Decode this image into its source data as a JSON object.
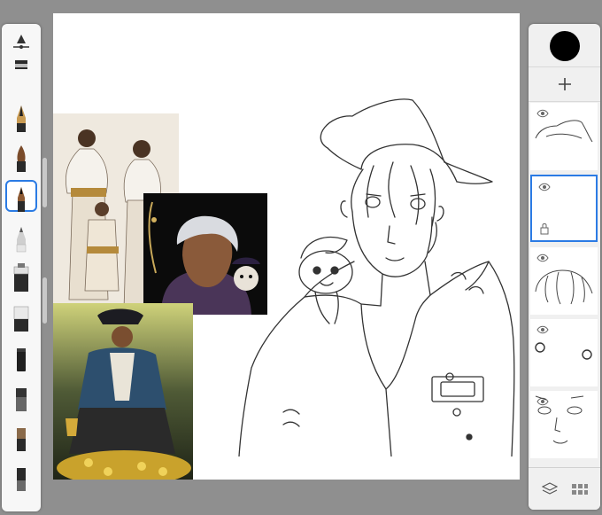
{
  "app": {
    "colors": {
      "background": "#8f8f8f",
      "canvas": "#ffffff",
      "panel": "#f0f0f0",
      "selection": "#2b7be4",
      "current_color": "#000000"
    }
  },
  "brush_palette": {
    "handle_icon": "triangle-slider-icon",
    "brushes": [
      {
        "icon": "marker-brush-icon",
        "selected": false
      },
      {
        "icon": "ink-pen-brush-icon",
        "selected": false
      },
      {
        "icon": "paintbrush-brush-icon",
        "selected": false
      },
      {
        "icon": "ballpoint-pen-brush-icon",
        "selected": true
      },
      {
        "icon": "pencil-brush-icon",
        "selected": false
      },
      {
        "icon": "airbrush-brush-icon",
        "selected": false
      },
      {
        "icon": "eraser-brush-icon",
        "selected": false
      },
      {
        "icon": "chalk-brush-icon",
        "selected": false
      },
      {
        "icon": "flat-brush-icon",
        "selected": false
      },
      {
        "icon": "sponge-brush-icon",
        "selected": false
      },
      {
        "icon": "wide-brush-icon",
        "selected": false
      }
    ]
  },
  "layers_panel": {
    "current_color": "#000000",
    "add_icon": "plus-icon",
    "layers": [
      {
        "name": "hat-sketch",
        "visible": true,
        "active": false
      },
      {
        "name": "empty",
        "visible": true,
        "active": true
      },
      {
        "name": "hair-sketch",
        "visible": true,
        "active": false
      },
      {
        "name": "eyes-sketch",
        "visible": true,
        "active": false
      },
      {
        "name": "face-sketch",
        "visible": true,
        "active": false
      }
    ],
    "footer_icons": [
      "layers-icon",
      "grid-icon"
    ]
  }
}
